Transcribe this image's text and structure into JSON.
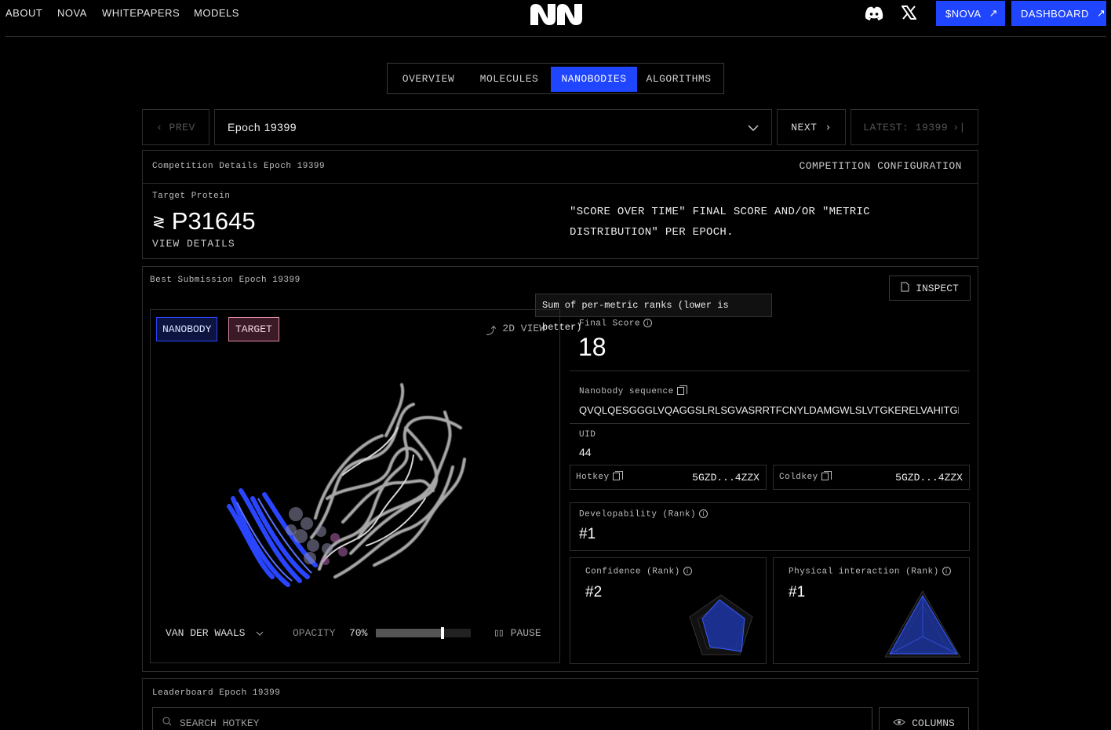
{
  "nav": {
    "links": [
      "ABOUT",
      "NOVA",
      "WHITEPAPERS",
      "MODELS"
    ],
    "nova_btn": "$NOVA",
    "dashboard_btn": "DASHBOARD",
    "icons": [
      "discord-icon",
      "x-icon"
    ]
  },
  "tabs": [
    "OVERVIEW",
    "MOLECULES",
    "NANOBODIES",
    "ALGORITHMS"
  ],
  "active_tab": "NANOBODIES",
  "epoch": {
    "prev": "PREV",
    "selected": "Epoch 19399",
    "next": "NEXT",
    "latest": "LATEST: 19399"
  },
  "competition": {
    "title": "Competition Details Epoch 19399",
    "config_link": "COMPETITION CONFIGURATION",
    "target_label": "Target Protein",
    "target_id": "P31645",
    "view_details": "VIEW DETAILS",
    "note": "\"SCORE OVER TIME\" FINAL SCORE AND/OR \"METRIC DISTRIBUTION\" PER EPOCH."
  },
  "best": {
    "title": "Best Submission Epoch 19399",
    "inspect": "INSPECT",
    "tooltip": "Sum of per-metric ranks (lower is better)",
    "viewer": {
      "nanobody_toggle": "NANOBODY",
      "target_toggle": "TARGET",
      "view_2d": "2D VIEW",
      "style_select": "VAN DER WAALS",
      "opacity_label": "OPACITY",
      "opacity_value": "70%",
      "opacity_fraction": 0.7,
      "pause": "PAUSE"
    },
    "final_score_label": "Final Score",
    "final_score": "18",
    "sequence_label": "Nanobody sequence",
    "sequence": "QVQLQESGGGLVQAGGSLRLSGVASRRTFCNYLDAMGWLSLVTGKERELVAHITGN…",
    "uid_label": "UID",
    "uid": "44",
    "hotkey_label": "Hotkey",
    "hotkey": "5GZD...4ZZX",
    "coldkey_label": "Coldkey",
    "coldkey": "5GZD...4ZZX",
    "developability_label": "Developability (Rank)",
    "developability": "#1",
    "confidence_label": "Confidence (Rank)",
    "confidence": "#2",
    "physical_label": "Physical interaction (Rank)",
    "physical": "#1"
  },
  "leaderboard": {
    "title": "Leaderboard Epoch 19399",
    "search_placeholder": "SEARCH HOTKEY",
    "columns_btn": "COLUMNS"
  },
  "colors": {
    "accent": "#1f45ff",
    "nanobody": "#2a45ff",
    "target_protein": "#9a9a9a"
  }
}
